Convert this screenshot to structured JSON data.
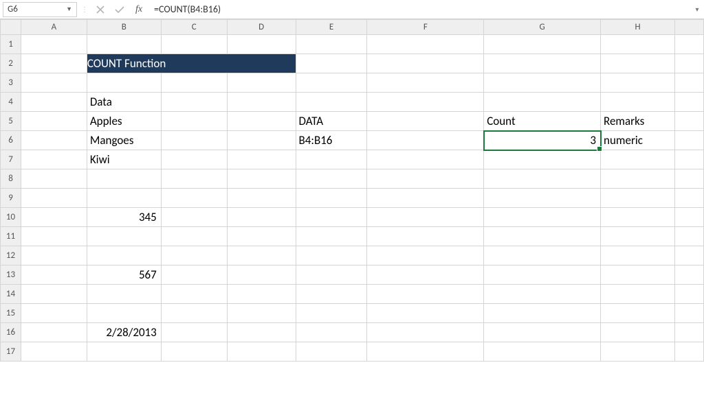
{
  "name_box": "G6",
  "formula": "=COUNT(B4:B16)",
  "columns": [
    "A",
    "B",
    "C",
    "D",
    "E",
    "F",
    "G",
    "H"
  ],
  "row_count": 17,
  "selected_cell": "G6",
  "title": "COUNT Function",
  "cells": {
    "B4": "Data",
    "B5": "Apples",
    "B6": "Mangoes",
    "B7": "Kiwi",
    "B10": "345",
    "B13": "567",
    "B16": "2/28/2013",
    "E5": "DATA",
    "E6": "B4:B16",
    "G5": "Count",
    "G6": "3",
    "H5": "Remarks",
    "H6": "numeric"
  }
}
